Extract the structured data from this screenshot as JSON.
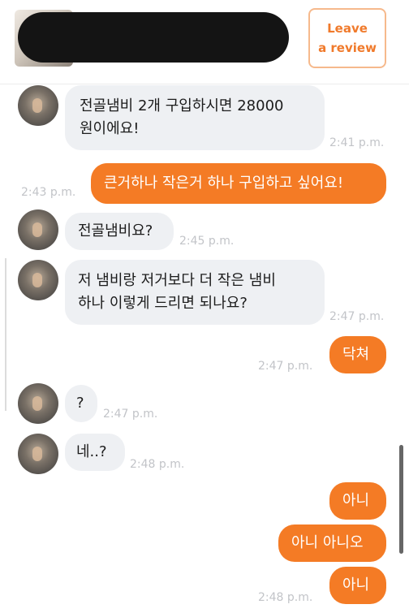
{
  "header": {
    "review_line1": "Leave",
    "review_line2": "a review"
  },
  "messages": [
    {
      "id": "m1",
      "direction": "in",
      "lines": [
        "전골냄비 2개 구입하시면 28000",
        "원이에요!"
      ],
      "time": "2:41 p.m."
    },
    {
      "id": "m2",
      "direction": "out",
      "lines": [
        "큰거하나 작은거 하나 구입하고 싶어요!"
      ],
      "time": "2:43 p.m."
    },
    {
      "id": "m3",
      "direction": "in",
      "lines": [
        "전골냄비요?"
      ],
      "time": "2:45 p.m."
    },
    {
      "id": "m4",
      "direction": "in",
      "lines": [
        "저 냄비랑 저거보다 더 작은 냄비",
        "하나 이렇게 드리면 되나요?"
      ],
      "time": "2:47 p.m."
    },
    {
      "id": "m5",
      "direction": "out",
      "lines": [
        "닥쳐"
      ],
      "time": "2:47 p.m."
    },
    {
      "id": "m6",
      "direction": "in",
      "lines": [
        "?"
      ],
      "time": "2:47 p.m."
    },
    {
      "id": "m7",
      "direction": "in",
      "lines": [
        "네..?"
      ],
      "time": "2:48 p.m."
    },
    {
      "id": "m8",
      "direction": "out",
      "lines": [
        "아니"
      ],
      "time": ""
    },
    {
      "id": "m9",
      "direction": "out",
      "lines": [
        "아니 아니오"
      ],
      "time": ""
    },
    {
      "id": "m10",
      "direction": "out",
      "lines": [
        "아니"
      ],
      "time": "2:48 p.m."
    }
  ],
  "colors": {
    "accent": "#f47b25",
    "incoming_bg": "#eef0f3",
    "timestamp": "#c2c4c8"
  }
}
